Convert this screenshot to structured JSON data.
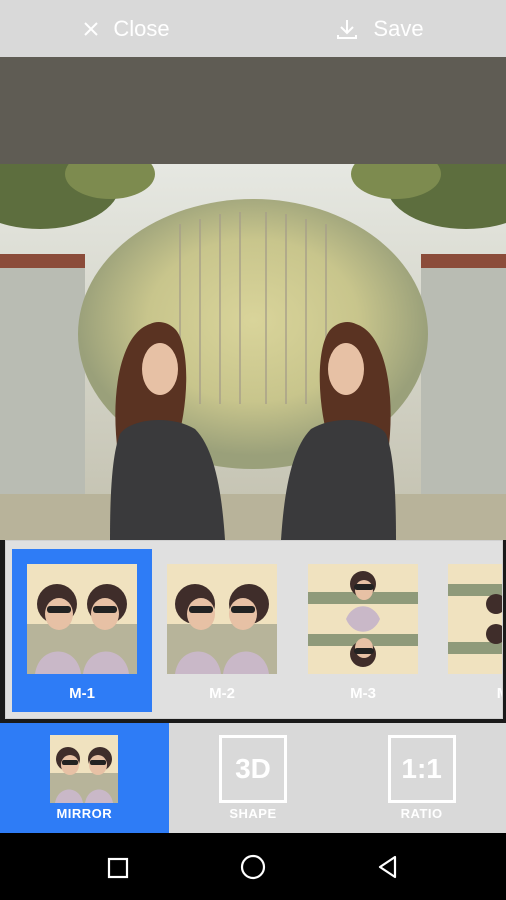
{
  "toolbar": {
    "close_label": "Close",
    "save_label": "Save"
  },
  "mirror_presets": [
    {
      "label": "M-1",
      "selected": true
    },
    {
      "label": "M-2",
      "selected": false
    },
    {
      "label": "M-3",
      "selected": false
    },
    {
      "label": "M",
      "selected": false
    }
  ],
  "tabs": [
    {
      "label": "MIRROR",
      "active": true,
      "icon": "mirror-thumbnail"
    },
    {
      "label": "SHAPE",
      "active": false,
      "icon_text": "3D"
    },
    {
      "label": "RATIO",
      "active": false,
      "icon_text": "1:1"
    }
  ],
  "colors": {
    "accent": "#2e7cf6",
    "bar_bg": "#d9d9d9",
    "strip_bg": "#5f5c54"
  }
}
